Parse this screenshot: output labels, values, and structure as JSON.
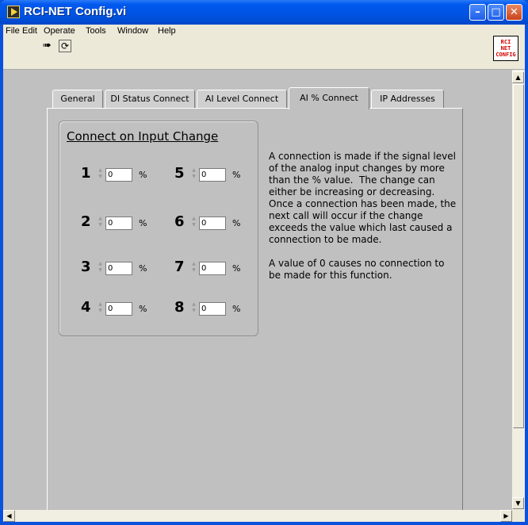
{
  "window": {
    "title": "RCI-NET Config.vi",
    "buttons": {
      "minimize": "–",
      "maximize": "□",
      "close": "✕"
    }
  },
  "menubar": {
    "items": [
      "File",
      "Edit",
      "Operate",
      "Tools",
      "Window",
      "Help"
    ]
  },
  "toolbar": {
    "run_icon": "run-arrow-icon",
    "run_continuous_icon": "run-continuously-icon",
    "run_glyph": "➠",
    "cont_glyph": "⟳"
  },
  "vi_icon": {
    "lines": [
      "RCI",
      "NET",
      "CONFIG"
    ]
  },
  "tabs": [
    {
      "label": "General"
    },
    {
      "label": "DI Status Connect"
    },
    {
      "label": "AI Level Connect"
    },
    {
      "label": "AI % Connect"
    },
    {
      "label": "IP Addresses"
    }
  ],
  "active_tab": "AI % Connect",
  "group": {
    "title": "Connect on Input Change",
    "unit": "%",
    "channels": [
      {
        "label": "1",
        "value": "0"
      },
      {
        "label": "2",
        "value": "0"
      },
      {
        "label": "3",
        "value": "0"
      },
      {
        "label": "4",
        "value": "0"
      },
      {
        "label": "5",
        "value": "0"
      },
      {
        "label": "6",
        "value": "0"
      },
      {
        "label": "7",
        "value": "0"
      },
      {
        "label": "8",
        "value": "0"
      }
    ]
  },
  "description": {
    "paragraph1": "A connection is made if the signal level of the analog input changes by more than the % value.  The change can either be increasing or decreasing. Once a connection has been made, the next call will occur if the change exceeds the value which last caused a connection to be made.",
    "paragraph2": "A value of 0 causes no connection to be made for this function."
  },
  "colors": {
    "titlebar": "#0054e3",
    "panel": "#c0c0c0",
    "menubar": "#ece9d8",
    "vi_icon_text": "#d00000"
  }
}
